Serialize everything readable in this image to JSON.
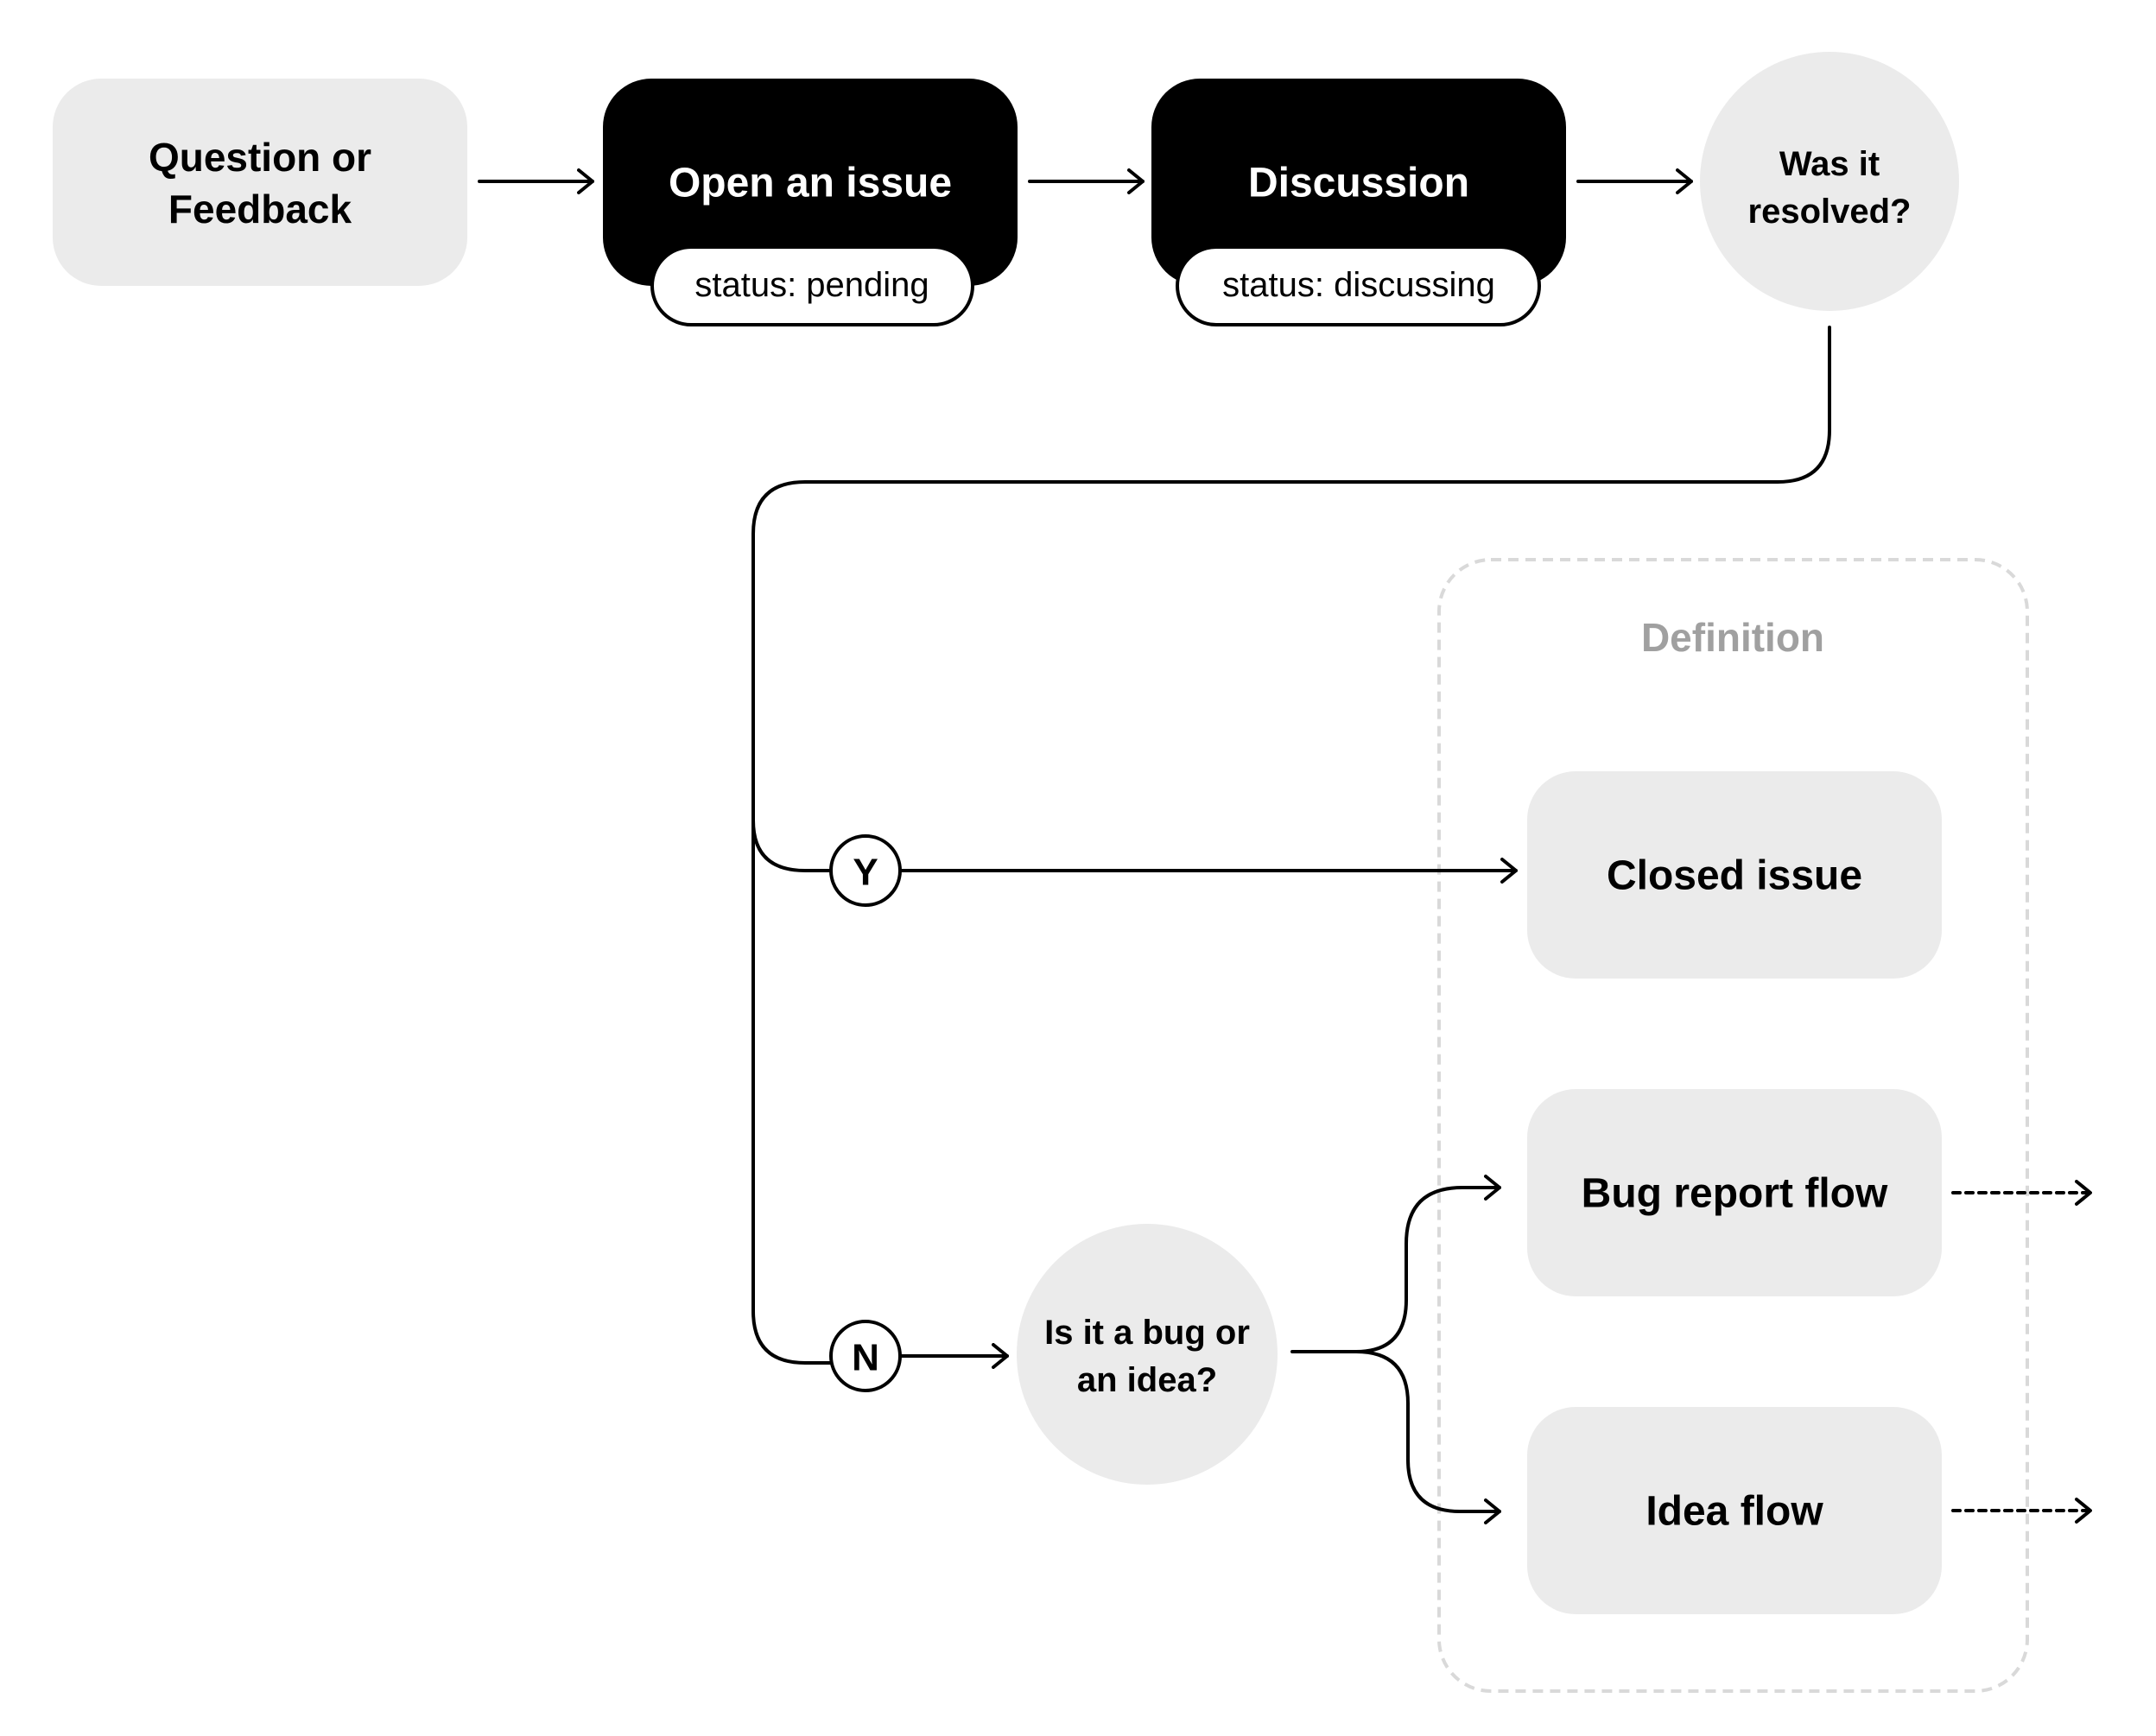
{
  "nodes": {
    "question": {
      "line1": "Question or",
      "line2": "Feedback"
    },
    "open_issue": {
      "label": "Open an issue",
      "status": "status: pending"
    },
    "discussion": {
      "label": "Discussion",
      "status": "status: discussing"
    },
    "resolved": {
      "line1": "Was it",
      "line2": "resolved?"
    },
    "yes": {
      "label": "Y"
    },
    "no": {
      "label": "N"
    },
    "bug_or_idea": {
      "line1": "Is it a bug or",
      "line2": "an idea?"
    },
    "closed_issue": {
      "label": "Closed issue"
    },
    "bug_report_flow": {
      "label": "Bug report flow"
    },
    "idea_flow": {
      "label": "Idea flow"
    }
  },
  "definition_group": {
    "title": "Definition"
  },
  "colors": {
    "node_fill": "#ebebeb",
    "dark_fill": "#000000",
    "group_border": "#d9d9d9",
    "group_title": "#a0a0a0"
  }
}
